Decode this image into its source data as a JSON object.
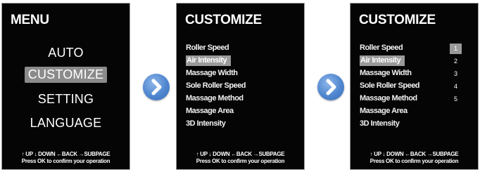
{
  "menu_screen": {
    "title": "MENU",
    "items": [
      {
        "label": "AUTO"
      },
      {
        "label": "CUSTOMIZE"
      },
      {
        "label": "SETTING"
      },
      {
        "label": "LANGUAGE"
      }
    ],
    "selected": "CUSTOMIZE",
    "footer_line1": "↑ UP ↓ DOWN ←BACK →SUBPAGE",
    "footer_line2": "Press OK to confirm your operation"
  },
  "customize_screen_a": {
    "title": "CUSTOMIZE",
    "options": [
      {
        "label": "Roller Speed"
      },
      {
        "label": "Air Intensity"
      },
      {
        "label": "Massage Width"
      },
      {
        "label": "Sole Roller Speed"
      },
      {
        "label": "Massage Method"
      },
      {
        "label": "Massage Area"
      },
      {
        "label": "3D Intensity"
      }
    ],
    "selected": "Air Intensity",
    "footer_line1": "↑ UP ↓ DOWN ←BACK →SUBPAGE",
    "footer_line2": "Press OK to confirm your operation"
  },
  "customize_screen_b": {
    "title": "CUSTOMIZE",
    "options": [
      {
        "label": "Roller Speed"
      },
      {
        "label": "Air Intensity"
      },
      {
        "label": "Massage Width"
      },
      {
        "label": "Sole Roller Speed"
      },
      {
        "label": "Massage Method"
      },
      {
        "label": "Massage Area"
      },
      {
        "label": "3D Intensity"
      }
    ],
    "selected": "Air Intensity",
    "levels": [
      "1",
      "2",
      "3",
      "4",
      "5"
    ],
    "selected_level": "1",
    "footer_line1": "↑ UP ↓ DOWN ←BACK →SUBPAGE",
    "footer_line2": "Press OK to confirm your operation"
  },
  "arrows": {
    "icon": "chevron-right-icon",
    "color": "#4f86cf"
  },
  "colors": {
    "screen_bg": "#050505",
    "highlight": "#9a9a9a",
    "text": "#ffffff"
  }
}
